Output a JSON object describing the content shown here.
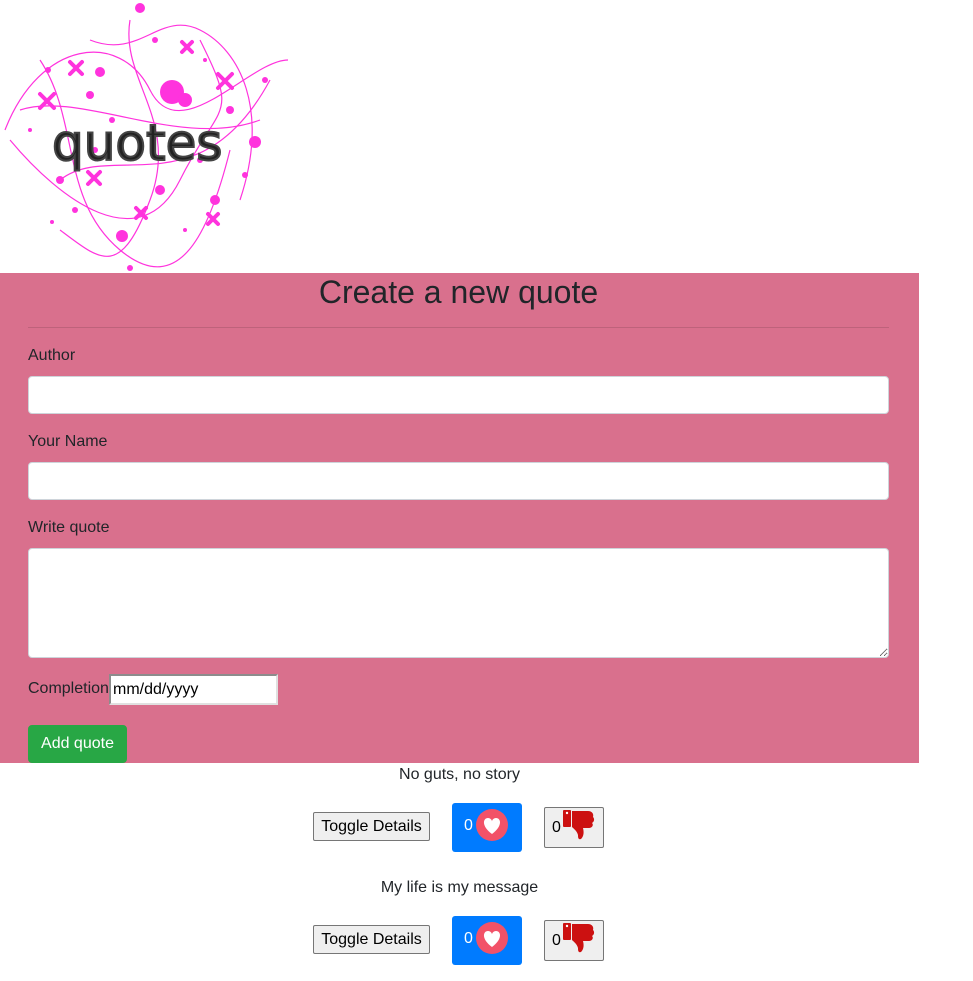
{
  "logo": {
    "text": "quotes",
    "accent_color": "#ff33dd"
  },
  "form": {
    "title": "Create a new quote",
    "author_label": "Author",
    "author_value": "",
    "name_label": "Your Name",
    "name_value": "",
    "quote_label": "Write quote",
    "quote_value": "",
    "completion_label": "Completion",
    "completion_placeholder": "mm/dd/yyyy",
    "submit_label": "Add quote",
    "background_color": "#d9708d",
    "submit_color": "#28a745"
  },
  "quotes": [
    {
      "text": "No guts, no story",
      "toggle_label": "Toggle Details",
      "likes": "0",
      "dislikes": "0",
      "like_icon": "heart-icon",
      "dislike_icon": "thumbs-down-icon"
    },
    {
      "text": "My life is my message",
      "toggle_label": "Toggle Details",
      "likes": "0",
      "dislikes": "0",
      "like_icon": "heart-icon",
      "dislike_icon": "thumbs-down-icon"
    }
  ]
}
